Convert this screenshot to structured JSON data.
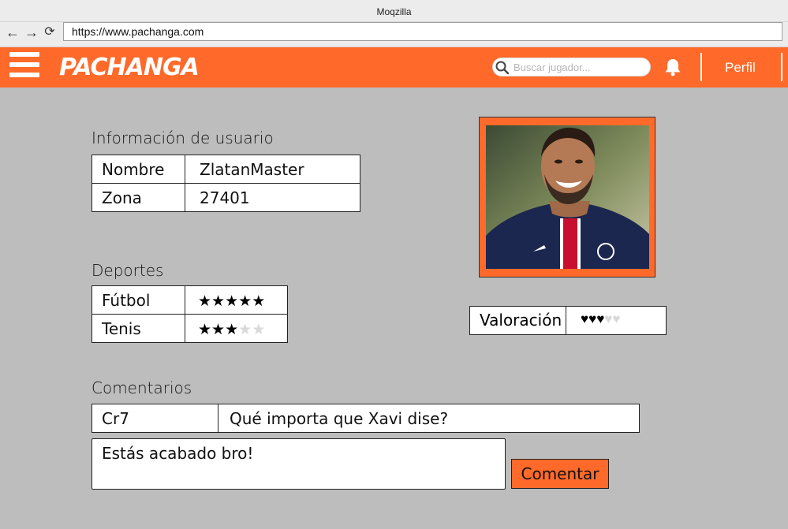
{
  "browser": {
    "window_title": "Moqzilla",
    "url": "https://www.pachanga.com"
  },
  "header": {
    "brand": "PACHANGA",
    "search_placeholder": "Buscar jugador...",
    "profile_label": "Perfil"
  },
  "user_info": {
    "heading": "Información de usuario",
    "rows": [
      {
        "key": "Nombre",
        "value": "ZlatanMaster"
      },
      {
        "key": "Zona",
        "value": "27401"
      }
    ]
  },
  "sports": {
    "heading": "Deportes",
    "items": [
      {
        "name": "Fútbol",
        "stars": 5,
        "max": 5
      },
      {
        "name": "Tenis",
        "stars": 3,
        "max": 5
      }
    ]
  },
  "rating": {
    "label": "Valoración",
    "hearts": 3,
    "max": 5
  },
  "comments": {
    "heading": "Comentarios",
    "items": [
      {
        "author": "Cr7",
        "text": "Qué importa que Xavi dise?"
      }
    ],
    "draft": "Estás acabado bro!",
    "submit_label": "Comentar"
  },
  "colors": {
    "accent": "#ff6a2a",
    "background": "#bdbdbd"
  }
}
